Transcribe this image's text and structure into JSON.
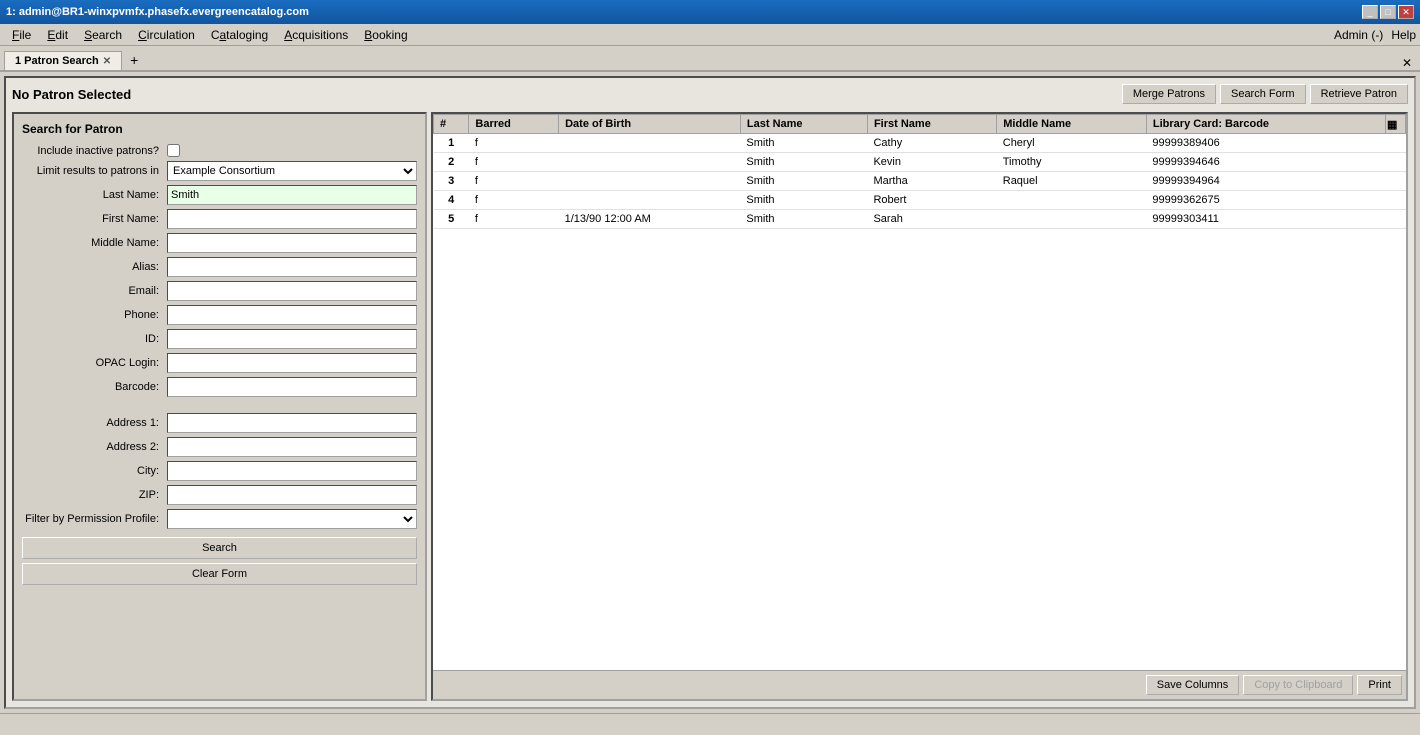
{
  "titlebar": {
    "text": "1: admin@BR1-winxpvmfx.phasefx.evergreencatalog.com"
  },
  "winbuttons": {
    "minimize": "_",
    "maximize": "□",
    "close": "✕"
  },
  "menubar": {
    "items": [
      "File",
      "Edit",
      "Search",
      "Circulation",
      "Cataloging",
      "Acquisitions",
      "Booking"
    ],
    "underline": [
      0,
      0,
      0,
      0,
      0,
      0,
      0
    ],
    "right_items": [
      "Admin (-)",
      "Help"
    ]
  },
  "tabs": {
    "active_tab": "1 Patron Search",
    "add_label": "+"
  },
  "header": {
    "no_patron": "No Patron Selected",
    "merge_btn": "Merge Patrons",
    "search_form_btn": "Search Form",
    "retrieve_btn": "Retrieve Patron"
  },
  "search_form": {
    "title": "Search for Patron",
    "include_inactive_label": "Include inactive patrons?",
    "limit_results_label": "Limit results to patrons in",
    "limit_options": [
      "Example Consortium"
    ],
    "limit_selected": "Example Consortium",
    "last_name_label": "Last Name:",
    "last_name_value": "Smith",
    "first_name_label": "First Name:",
    "middle_name_label": "Middle Name:",
    "alias_label": "Alias:",
    "email_label": "Email:",
    "phone_label": "Phone:",
    "id_label": "ID:",
    "opac_login_label": "OPAC Login:",
    "barcode_label": "Barcode:",
    "address1_label": "Address 1:",
    "address2_label": "Address 2:",
    "city_label": "City:",
    "zip_label": "ZIP:",
    "filter_profile_label": "Filter by Permission Profile:",
    "search_btn": "Search",
    "clear_btn": "Clear Form"
  },
  "results": {
    "columns": [
      "#",
      "Barred",
      "Date of Birth",
      "Last Name",
      "First Name",
      "Middle Name",
      "Library Card: Barcode"
    ],
    "rows": [
      {
        "num": "1",
        "barred": "f",
        "dob": "",
        "last": "Smith",
        "first": "Cathy",
        "middle": "Cheryl",
        "barcode": "99999389406"
      },
      {
        "num": "2",
        "barred": "f",
        "dob": "",
        "last": "Smith",
        "first": "Kevin",
        "middle": "Timothy",
        "barcode": "99999394646"
      },
      {
        "num": "3",
        "barred": "f",
        "dob": "",
        "last": "Smith",
        "first": "Martha",
        "middle": "Raquel",
        "barcode": "99999394964"
      },
      {
        "num": "4",
        "barred": "f",
        "dob": "",
        "last": "Smith",
        "first": "Robert",
        "middle": "",
        "barcode": "99999362675"
      },
      {
        "num": "5",
        "barred": "f",
        "dob": "1/13/90 12:00 AM",
        "last": "Smith",
        "first": "Sarah",
        "middle": "",
        "barcode": "99999303411"
      }
    ],
    "save_columns_btn": "Save Columns",
    "copy_btn": "Copy to Clipboard",
    "print_btn": "Print"
  }
}
